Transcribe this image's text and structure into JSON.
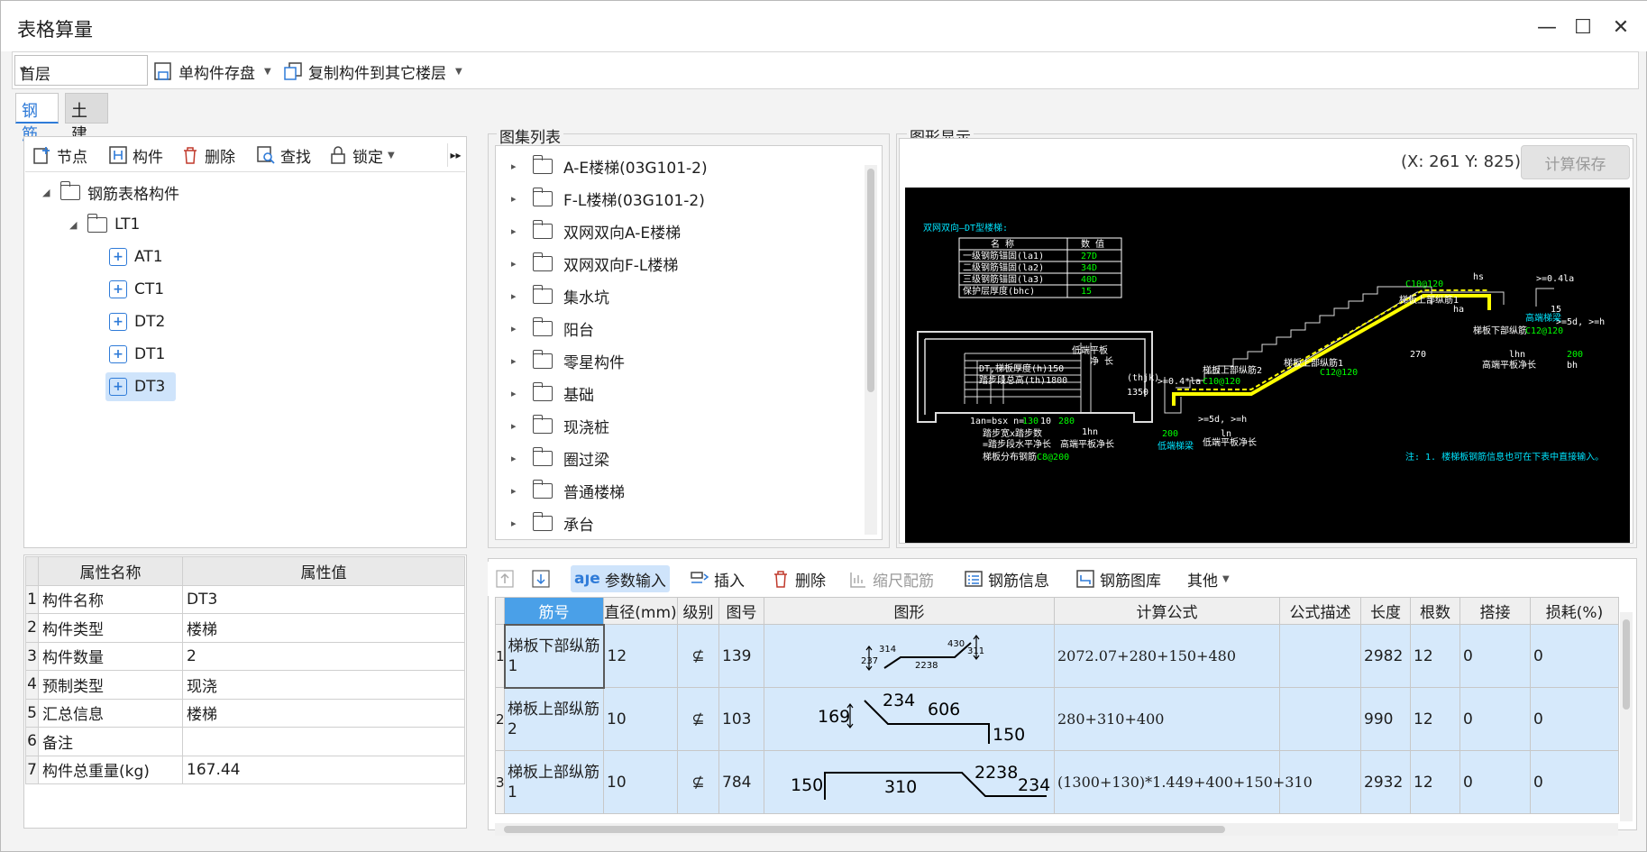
{
  "window": {
    "title": "表格算量"
  },
  "toolbar": {
    "floor": "首层",
    "save_component": "单构件存盘",
    "copy_component": "复制构件到其它楼层"
  },
  "tabs": [
    "钢筋",
    "土建"
  ],
  "left_toolbar": {
    "node": "节点",
    "component": "构件",
    "delete": "删除",
    "find": "查找",
    "lock": "锁定"
  },
  "tree": {
    "root": "钢筋表格构件",
    "group": "LT1",
    "items": [
      "AT1",
      "CT1",
      "DT2",
      "DT1",
      "DT3"
    ],
    "selected": "DT3"
  },
  "props": {
    "headers": [
      "属性名称",
      "属性值"
    ],
    "rows": [
      {
        "i": "1",
        "name": "构件名称",
        "value": "DT3"
      },
      {
        "i": "2",
        "name": "构件类型",
        "value": "楼梯"
      },
      {
        "i": "3",
        "name": "构件数量",
        "value": "2"
      },
      {
        "i": "4",
        "name": "预制类型",
        "value": "现浇"
      },
      {
        "i": "5",
        "name": "汇总信息",
        "value": "楼梯"
      },
      {
        "i": "6",
        "name": "备注",
        "value": ""
      },
      {
        "i": "7",
        "name": "构件总重量(kg)",
        "value": "167.44"
      }
    ]
  },
  "atlas": {
    "title": "图集列表",
    "items": [
      "A-E楼梯(03G101-2)",
      "F-L楼梯(03G101-2)",
      "双网双向A-E楼梯",
      "双网双向F-L楼梯",
      "集水坑",
      "阳台",
      "零星构件",
      "基础",
      "现浇桩",
      "圈过梁",
      "普通楼梯",
      "承台"
    ]
  },
  "graphic": {
    "title": "图形显示",
    "coord": "(X: 261 Y: 825)",
    "calc_save": "计算保存",
    "cad": {
      "heading": "双网双向—DT型楼梯:",
      "table_header": [
        "名 称",
        "数 值"
      ],
      "table_rows": [
        [
          "一级钢筋锚固(la1)",
          "27D"
        ],
        [
          "二级钢筋锚固(la2)",
          "34D"
        ],
        [
          "三级钢筋锚固(la3)",
          "40D"
        ],
        [
          "保护层厚度(bhc)",
          "15"
        ]
      ],
      "plan_label1": "DT,梯板厚度(h)150",
      "plan_label2": "踏步段总高(th)1800",
      "step_width": "踏步宽x踏步数",
      "step_eq": "=踏步段水平净长",
      "step_eq2": "高端平板净长",
      "dist_bar_label": "梯板分布钢筋",
      "dist_bar_value": "C8@200",
      "low_platform": "低端平板净长",
      "high_platform": "高端平板净长",
      "upper_bar1": "梯板上部纵筋1",
      "upper_bar2": "梯板上部纵筋2",
      "lower_bar": "梯板下部纵筋",
      "lower_bar_val": "C12@120",
      "c10_1": "C10@120",
      "c10_2": "C10@120",
      "c12": "C12@120",
      "low_beam": "低端梯梁",
      "high_beam": "高端梯梁",
      "note": "注: 1. 楼梯板钢筋信息也可在下表中直接输入。",
      "dim_1350": "1350",
      "dim_200a": "200",
      "dim_200b": "200",
      "dim_130": "130",
      "dim_280": "280",
      "dim_10": "10",
      "dim_270": "270",
      "dim_15": "15",
      "lbl_hs": "hs",
      "lbl_ha": "ha",
      "lbl_ln": "ln",
      "lbl_lhn": "lhn",
      "lbl_bh": "bh",
      "lbl_thjk": "(thjk)",
      "lbl_1hn": "1hn",
      "lbl_104": ">=0.4*la",
      "lbl_5d": ">=5d, >=h",
      "lbl_5d2": ">=5d, >=h",
      "lbl_041": ">=0.4la",
      "lbl_1an": "1an=bsx n=",
      "lbl_dilowplat": "低端平板",
      "lbl_jing": "净 长"
    }
  },
  "bottom_toolbar": {
    "param_input": "参数输入",
    "insert": "插入",
    "delete": "删除",
    "scale_rebar": "缩尺配筋",
    "rebar_info": "钢筋信息",
    "rebar_lib": "钢筋图库",
    "other": "其他"
  },
  "grid": {
    "headers": [
      "筋号",
      "直径(mm)",
      "级别",
      "图号",
      "图形",
      "计算公式",
      "公式描述",
      "长度",
      "根数",
      "搭接",
      "损耗(%)"
    ],
    "rows": [
      {
        "i": "1",
        "name": "梯板下部纵筋1",
        "dia": "12",
        "grade": "⊈",
        "fig": "139",
        "formula": "2072.07+280+150+480",
        "desc": "",
        "len": "2982",
        "count": "12",
        "lap": "0",
        "loss": "0",
        "shape": {
          "a": "237",
          "b": "314",
          "c": "2238",
          "d": "430",
          "e": "311"
        }
      },
      {
        "i": "2",
        "name": "梯板上部纵筋2",
        "dia": "10",
        "grade": "⊈",
        "fig": "103",
        "formula": "280+310+400",
        "desc": "",
        "len": "990",
        "count": "12",
        "lap": "0",
        "loss": "0",
        "shape": {
          "a": "169",
          "b": "234",
          "c": "606",
          "d": "150"
        }
      },
      {
        "i": "3",
        "name": "梯板上部纵筋1",
        "dia": "10",
        "grade": "⊈",
        "fig": "784",
        "formula": "(1300+130)*1.449+400+150+310",
        "desc": "",
        "len": "2932",
        "count": "12",
        "lap": "0",
        "loss": "0",
        "shape": {
          "a": "150",
          "b": "310",
          "c": "2238",
          "d": "234"
        }
      }
    ]
  }
}
